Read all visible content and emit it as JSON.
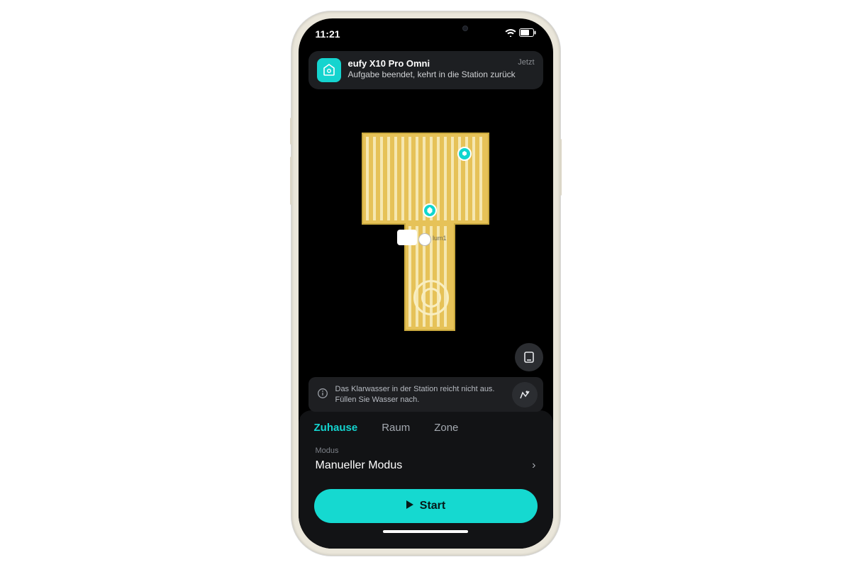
{
  "status_bar": {
    "time": "11:21"
  },
  "notification": {
    "app": "eufy X10 Pro Omni",
    "time": "Jetzt",
    "message": "Aufgabe beendet, kehrt in die Station zurück"
  },
  "map": {
    "room_label": "lum1"
  },
  "warning": {
    "message": "Das Klarwasser in der Station reicht nicht aus. Füllen Sie Wasser nach."
  },
  "tabs": {
    "home": "Zuhause",
    "room": "Raum",
    "zone": "Zone"
  },
  "mode_section": {
    "label": "Modus",
    "value": "Manueller Modus"
  },
  "start_button": "Start",
  "colors": {
    "accent": "#15d9d0"
  }
}
